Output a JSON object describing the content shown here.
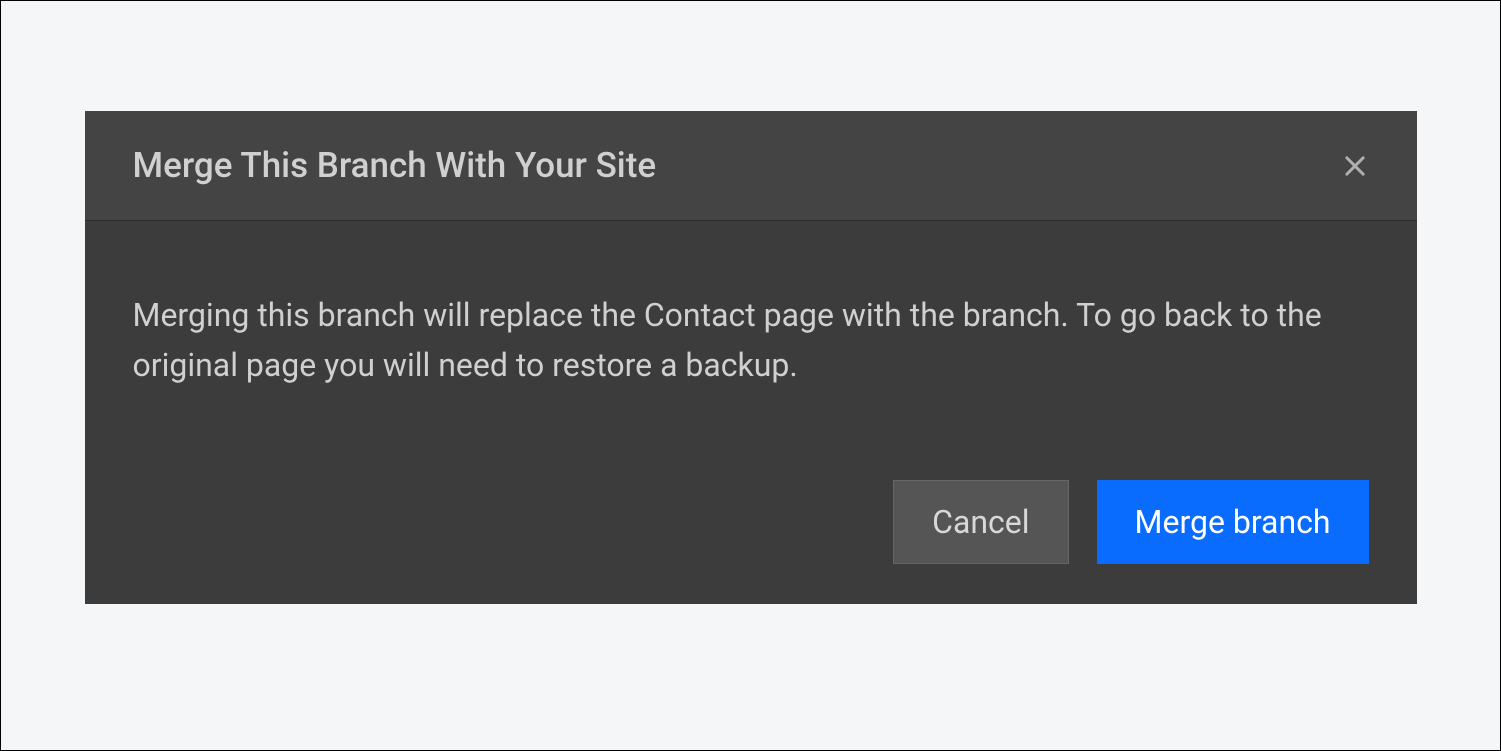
{
  "dialog": {
    "title": "Merge This Branch With Your Site",
    "message": "Merging this branch will replace the Contact page with the branch. To go back to the original page you will need to restore a backup.",
    "cancel_label": "Cancel",
    "merge_label": "Merge branch"
  }
}
